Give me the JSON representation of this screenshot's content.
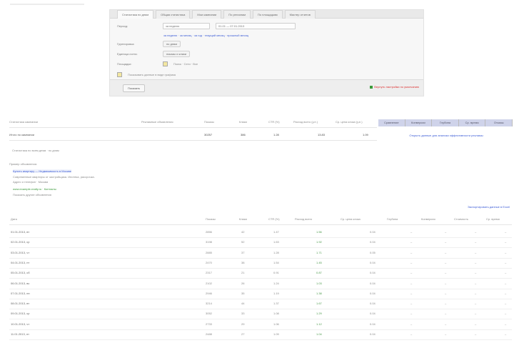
{
  "panel": {
    "tabs": [
      "Статистика по дням",
      "Общая статистика",
      "Мои кампании",
      "По регионам",
      "По площадкам",
      "Мастер отчетов"
    ],
    "rows": [
      {
        "label": "Период:",
        "value": "за неделю",
        "extra": "01.01 — 07.01.2013"
      },
      {
        "label": "",
        "links": "за неделю · за месяц · за год · текущий месяц · прошлый месяц"
      },
      {
        "label": "Группировка:",
        "value": "по дням"
      },
      {
        "label": "Единица счета:",
        "value": "показы и клики"
      },
      {
        "label": "Площадки:",
        "value": "Поиск  ·  Сети  ·  Все"
      }
    ],
    "checkbox_label": "Показывать данные в виде графика",
    "apply_label": "Показать",
    "reset_label": "Вернуть настройки по умолчанию"
  },
  "summary": {
    "headers": [
      "Статистика кампании",
      "Рекламные объявления",
      "Показы",
      "Клики",
      "CTR (%)",
      "Расход всего (у.е.)",
      "Ср. цена клика (у.е.)"
    ],
    "row": [
      "Итого по кампании",
      "",
      "30257",
      "386",
      "1.28",
      "13.83",
      "1.09"
    ],
    "compare_tabs": [
      "Сравнение",
      "Конверсии",
      "Глубина",
      "Ср. время",
      "Отказы"
    ],
    "compare_link": "Открыть данные для анализа эффективности рекламы",
    "note": "Статистика по всем дням · по дням"
  },
  "ad_preview": {
    "caption": "Пример объявления:",
    "title": "Купить квартиру — Недвижимость в Москве",
    "line1": "Современные квартиры от застройщика. Ипотека, рассрочка.",
    "line2": "Адрес и телефон · Москва",
    "url": "www.example-realty.ru · Контакты",
    "extra": "Показать другие объявления",
    "right_link": "Экспортировать данные в Excel"
  },
  "detail": {
    "headers": [
      "Дата",
      "Показы",
      "Клики",
      "CTR (%)",
      "Расход всего",
      "Ср. цена клика",
      "Глубина",
      "Конверсия",
      "Стоимость",
      "Ср. время"
    ],
    "rows": [
      [
        "01.01.2013, вт",
        "2856",
        "42",
        "1.47",
        "1.56",
        "0.04",
        "–",
        "–",
        "–",
        "–"
      ],
      [
        "02.01.2013, ср",
        "3198",
        "52",
        "1.63",
        "1.92",
        "0.04",
        "–",
        "–",
        "–",
        "–"
      ],
      [
        "03.01.2013, чт",
        "2885",
        "37",
        "1.28",
        "1.71",
        "0.05",
        "–",
        "–",
        "–",
        "–"
      ],
      [
        "04.01.2013, пт",
        "2470",
        "38",
        "1.54",
        "1.45",
        "0.04",
        "–",
        "–",
        "–",
        "–"
      ],
      [
        "05.01.2013, сб",
        "2317",
        "21",
        "0.91",
        "0.87",
        "0.04",
        "–",
        "–",
        "–",
        "–"
      ],
      [
        "06.01.2013, вс",
        "2102",
        "26",
        "1.24",
        "1.03",
        "0.04",
        "–",
        "–",
        "–",
        "–"
      ],
      [
        "07.01.2013, пн",
        "2946",
        "35",
        "1.19",
        "1.38",
        "0.04",
        "–",
        "–",
        "–",
        "–"
      ],
      [
        "08.01.2013, вт",
        "3214",
        "44",
        "1.37",
        "1.67",
        "0.04",
        "–",
        "–",
        "–",
        "–"
      ],
      [
        "09.01.2013, ср",
        "3052",
        "33",
        "1.08",
        "1.29",
        "0.04",
        "–",
        "–",
        "–",
        "–"
      ],
      [
        "10.01.2013, чт",
        "2733",
        "29",
        "1.06",
        "1.12",
        "0.04",
        "–",
        "–",
        "–",
        "–"
      ],
      [
        "11.01.2013, пт",
        "2488",
        "27",
        "1.09",
        "1.04",
        "0.04",
        "–",
        "–",
        "–",
        "–"
      ]
    ]
  }
}
